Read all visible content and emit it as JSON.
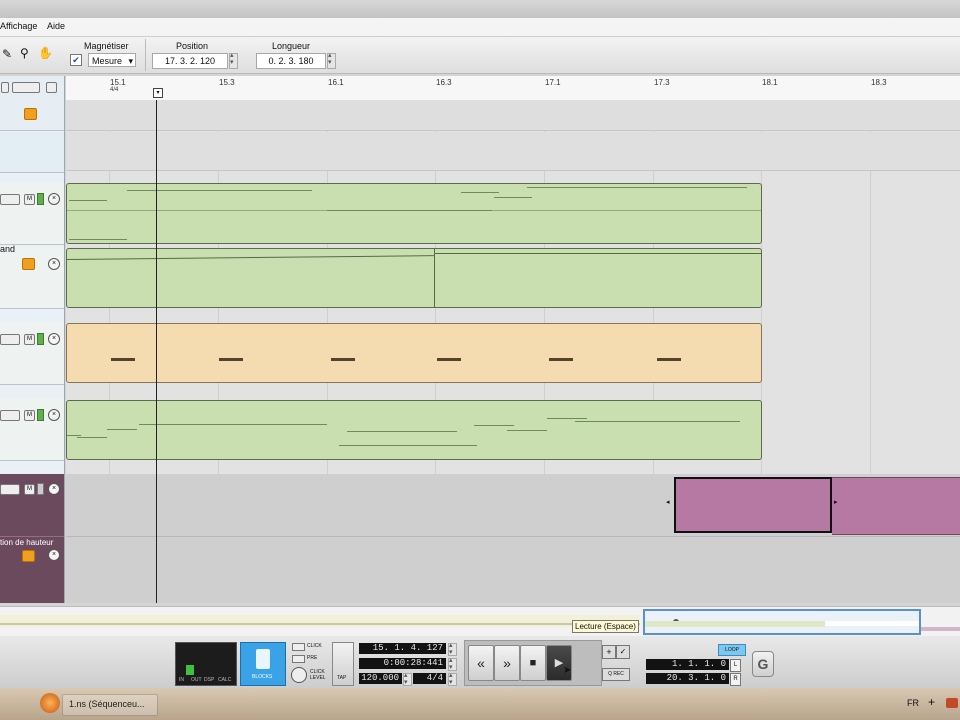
{
  "menu": {
    "items": [
      "Affichage",
      "Aide"
    ]
  },
  "toolbar": {
    "snap_label": "Magnétiser",
    "snap_value": "Mesure",
    "position_label": "Position",
    "position_value": "17.  3.  2. 120",
    "length_label": "Longueur",
    "length_value": "0.  2.  3. 180"
  },
  "ruler": {
    "labels": [
      "15.1",
      "15.3",
      "16.1",
      "16.3",
      "17.1",
      "17.3",
      "18.1",
      "18.3"
    ],
    "sig": "4/4"
  },
  "tracks": {
    "names": [
      "and",
      "tion de hauteur"
    ]
  },
  "transport": {
    "out_labels": [
      "IN",
      "OUT",
      "DSP",
      "CALC"
    ],
    "blocks_label": "BLOCKS",
    "click_label": "CLICK",
    "pre_label": "PRE",
    "click_level_label": "CLICK LEVEL",
    "tap_label": "TAP",
    "position_bars": "15.  1.  4. 127",
    "position_time": "0:00:28:441",
    "tempo": "120.000",
    "signature": "4/4",
    "rewind_icon": "«",
    "ffwd_icon": "»",
    "stop_icon": "■",
    "play_icon": "▶",
    "tooltip": "Lecture (Espace)",
    "qrec_label": "Q REC",
    "loop_label": "LOOP",
    "loop_left": "1.  1.  1.    0",
    "loop_right": "20.  3.  1.    0",
    "l_label": "L",
    "r_label": "R"
  },
  "taskbar": {
    "app_label": "1.ns (Séquenceu...",
    "lang": "FR"
  }
}
